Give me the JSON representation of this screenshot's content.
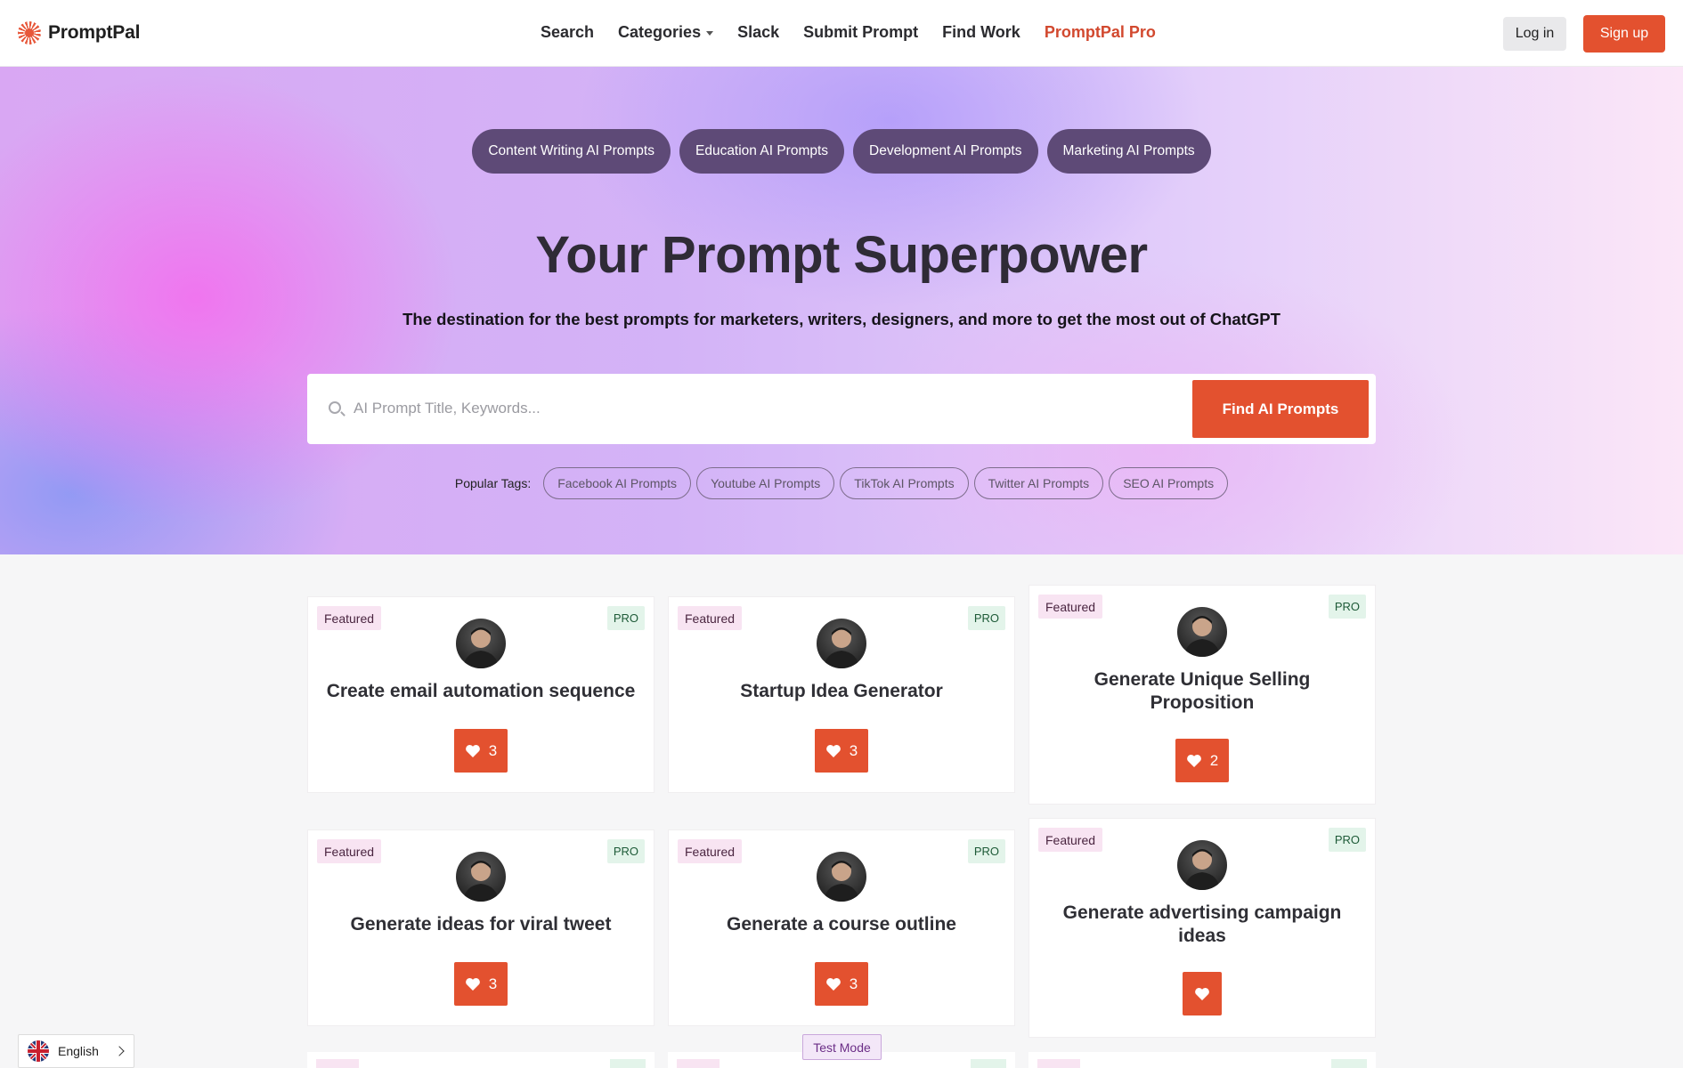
{
  "brand": {
    "name": "PromptPal"
  },
  "nav": {
    "items": [
      {
        "label": "Search"
      },
      {
        "label": "Categories"
      },
      {
        "label": "Slack"
      },
      {
        "label": "Submit Prompt"
      },
      {
        "label": "Find Work"
      },
      {
        "label": "PromptPal Pro"
      }
    ],
    "login": "Log in",
    "signup": "Sign up"
  },
  "hero": {
    "categories": [
      "Content Writing AI Prompts",
      "Education AI Prompts",
      "Development AI Prompts",
      "Marketing AI Prompts"
    ],
    "title": "Your Prompt Superpower",
    "subtitle": "The destination for the best prompts for marketers, writers, designers, and more to get the most out of ChatGPT",
    "search": {
      "placeholder": "AI Prompt Title, Keywords...",
      "value": "",
      "button": "Find AI Prompts"
    },
    "tags_label": "Popular Tags:",
    "tags": [
      "Facebook AI Prompts",
      "Youtube AI Prompts",
      "TikTok AI Prompts",
      "Twitter AI Prompts",
      "SEO AI Prompts"
    ]
  },
  "cards": [
    {
      "featured": "Featured",
      "pro": "PRO",
      "title": "Create email automation sequence",
      "likes": "3"
    },
    {
      "featured": "Featured",
      "pro": "PRO",
      "title": "Startup Idea Generator",
      "likes": "3"
    },
    {
      "featured": "Featured",
      "pro": "PRO",
      "title": "Generate Unique Selling Proposition",
      "likes": "2"
    },
    {
      "featured": "Featured",
      "pro": "PRO",
      "title": "Generate ideas for viral tweet",
      "likes": "3"
    },
    {
      "featured": "Featured",
      "pro": "PRO",
      "title": "Generate a course outline",
      "likes": "3"
    },
    {
      "featured": "Featured",
      "pro": "PRO",
      "title": "Generate advertising campaign ideas",
      "likes": ""
    }
  ],
  "footer": {
    "language": "English",
    "test_mode": "Test Mode"
  },
  "colors": {
    "accent": "#e3512f",
    "pill": "#5e4a77",
    "featured_bg": "#f8e4f2",
    "pro_bg": "#e3f4ea"
  },
  "icons": {
    "logo": "promptpal-sunburst-icon",
    "search": "search-icon",
    "like": "heart-icon",
    "language": "uk-flag-icon"
  }
}
